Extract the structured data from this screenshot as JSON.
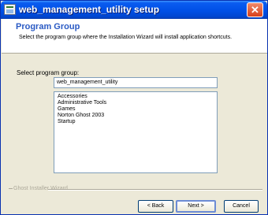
{
  "window": {
    "title": "web_management_utility setup",
    "close_glyph": "✕"
  },
  "header": {
    "title": "Program Group",
    "description": "Select the program group where the Installation Wizard will install application shortcuts."
  },
  "form": {
    "label": "Select program group:",
    "group_value": "web_management_utility",
    "groups": [
      "Accessories",
      "Administrative Tools",
      "Games",
      "Norton Ghost 2003",
      "Startup"
    ]
  },
  "footer": {
    "branding": "Ghost Installer Wizard"
  },
  "buttons": {
    "back": "< Back",
    "next": "Next >",
    "cancel": "Cancel"
  }
}
